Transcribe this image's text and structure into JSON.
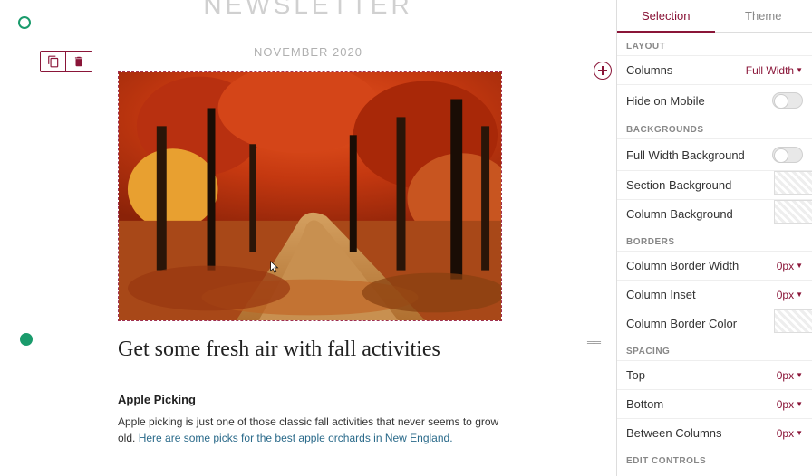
{
  "header": {
    "title": "NEWSLETTER",
    "date": "NOVEMBER 2020"
  },
  "article": {
    "title": "Get some fresh air with fall activities",
    "subtitle": "Apple Picking",
    "body_pre": "Apple picking is just one of those classic fall activities that never seems to grow old. ",
    "link_text": "Here are some picks for the best apple orchards in New England.",
    "link_post": ""
  },
  "panel": {
    "tabs": {
      "selection": "Selection",
      "theme": "Theme"
    },
    "sections": {
      "layout": "Layout",
      "backgrounds": "Backgrounds",
      "borders": "Borders",
      "spacing": "Spacing",
      "edit": "Edit Controls"
    },
    "rows": {
      "columns": {
        "label": "Columns",
        "value": "Full Width"
      },
      "hide_mobile": {
        "label": "Hide on Mobile"
      },
      "full_width_bg": {
        "label": "Full Width Background"
      },
      "section_bg": {
        "label": "Section Background"
      },
      "column_bg": {
        "label": "Column Background"
      },
      "border_width": {
        "label": "Column Border Width",
        "value": "0px"
      },
      "inset": {
        "label": "Column Inset",
        "value": "0px"
      },
      "border_color": {
        "label": "Column Border Color"
      },
      "top": {
        "label": "Top",
        "value": "0px"
      },
      "bottom": {
        "label": "Bottom",
        "value": "0px"
      },
      "between": {
        "label": "Between Columns",
        "value": "0px"
      }
    }
  }
}
